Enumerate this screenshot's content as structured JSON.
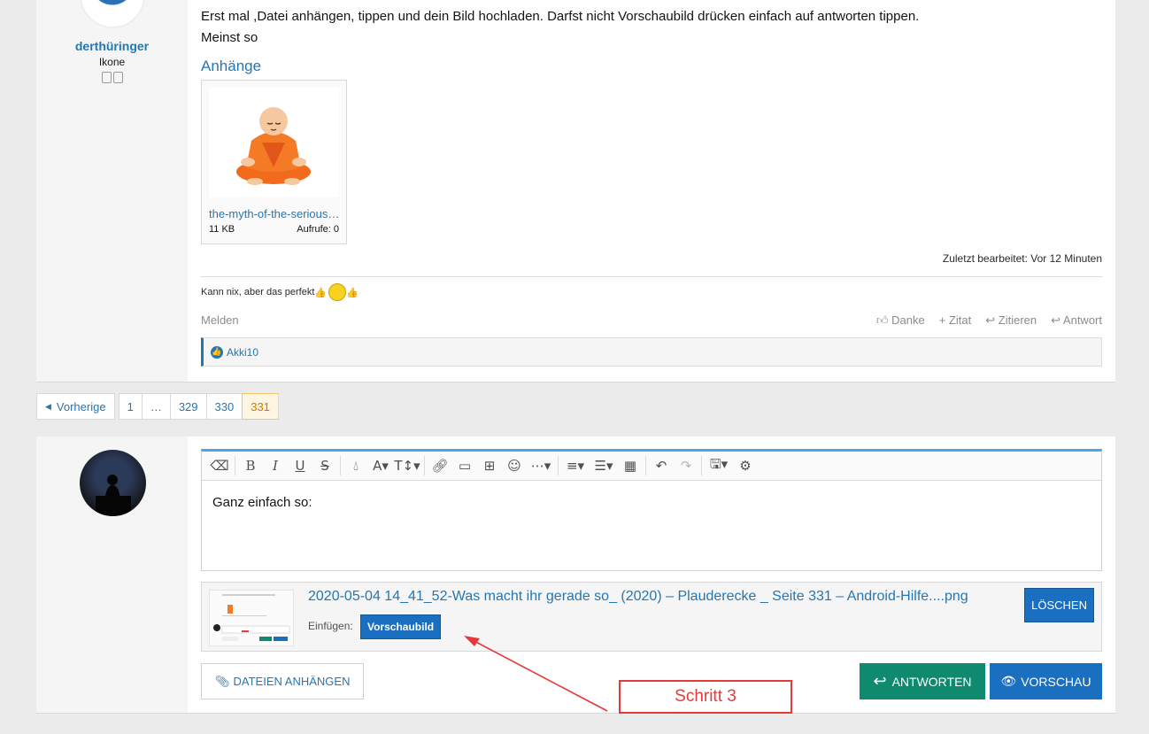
{
  "post": {
    "user": {
      "name": "derthüringer",
      "title": "Ikone"
    },
    "message": [
      "Erst mal ,Datei anhängen, tippen und dein Bild hochladen. Darfst nicht Vorschaubild drücken einfach auf antworten tippen.",
      "Meinst so"
    ],
    "attachments_title": "Anhänge",
    "attachment": {
      "name": "the-myth-of-the-serious-yogi.png",
      "size": "11 KB",
      "views": "Aufrufe: 0"
    },
    "edited": "Zuletzt bearbeitet: Vor 12 Minuten",
    "signature": "Kann nix, aber das perfekt",
    "report": "Melden",
    "actions": {
      "like": "Danke",
      "multiquote": "Zitat",
      "quote": "Zitieren",
      "reply": "Antwort"
    },
    "liked_by": "Akki10"
  },
  "pagination": {
    "prev": "Vorherige",
    "pages": [
      "1",
      "…",
      "329",
      "330",
      "331"
    ],
    "current": "331"
  },
  "editor": {
    "text": "Ganz einfach so:",
    "toolbar_icons": [
      "eraser-icon",
      "bold-icon",
      "italic-icon",
      "underline-icon",
      "strikethrough-icon",
      "color-icon",
      "font-family-icon",
      "font-size-icon",
      "link-icon",
      "image-icon",
      "media-icon",
      "smilie-icon",
      "more-icon",
      "align-icon",
      "list-icon",
      "table-icon",
      "undo-icon",
      "redo-icon",
      "drafts-icon",
      "settings-icon"
    ]
  },
  "upload": {
    "filename": "2020-05-04 14_41_52-Was macht ihr gerade so_ (2020) – Plauderecke _ Seite 331 – Android-Hilfe....png",
    "insert_label": "Einfügen:",
    "thumbnail_button": "Vorschaubild",
    "delete_button": "LÖSCHEN"
  },
  "buttons": {
    "attach": "DATEIEN ANHÄNGEN",
    "reply": "ANTWORTEN",
    "preview": "VORSCHAU"
  },
  "annotation": {
    "label": "Schritt 3",
    "color": "#e53a3a"
  },
  "colors": {
    "accent": "#2577b1",
    "primary_button": "#1b6fc1",
    "reply_button": "#0f8a6f"
  }
}
